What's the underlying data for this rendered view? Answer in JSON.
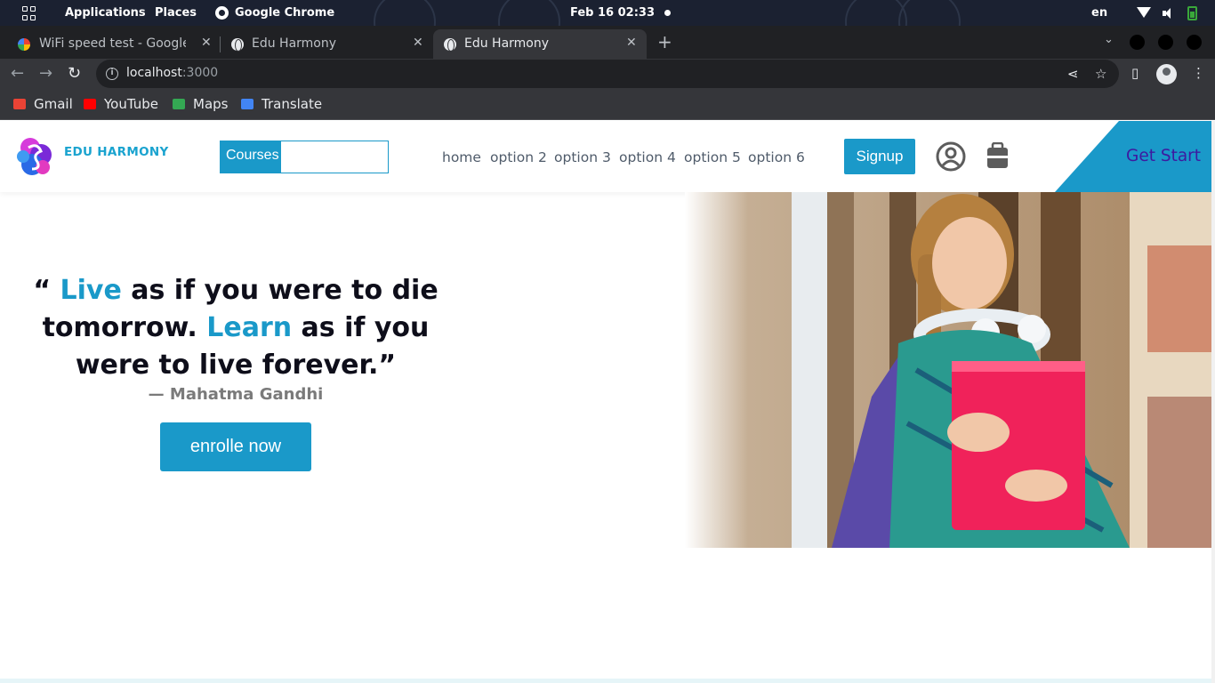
{
  "system_bar": {
    "applications": "Applications",
    "places": "Places",
    "active_app": "Google Chrome",
    "datetime": "Feb 16  02:33",
    "language": "en"
  },
  "browser": {
    "tabs": [
      {
        "title": "WiFi speed test - Google Search",
        "active": false
      },
      {
        "title": "Edu Harmony",
        "active": false
      },
      {
        "title": "Edu Harmony",
        "active": true
      }
    ],
    "url_host": "localhost",
    "url_port": ":3000",
    "bookmarks": [
      {
        "label": "Gmail",
        "color": "#ea4335"
      },
      {
        "label": "YouTube",
        "color": "#ff0000"
      },
      {
        "label": "Maps",
        "color": "#34a853"
      },
      {
        "label": "Translate",
        "color": "#4285f4"
      }
    ]
  },
  "site": {
    "brand": "EDU HARMONY",
    "search_label": "Courses",
    "search_value": "",
    "nav": [
      "home",
      "option 2",
      "option 3",
      "option 4",
      "option 5",
      "option 6"
    ],
    "signup_label": "Signup",
    "get_start_label": "Get Start",
    "accent_color": "#1a99c9"
  },
  "hero": {
    "quote_open": "“ ",
    "word1": "Live",
    "quote_part1": " as if you were to die tomorrow. ",
    "word2": "Learn",
    "quote_part2": " as if you were to live forever.”",
    "author": "— Mahatma Gandhi",
    "cta_label": "enrolle now"
  }
}
